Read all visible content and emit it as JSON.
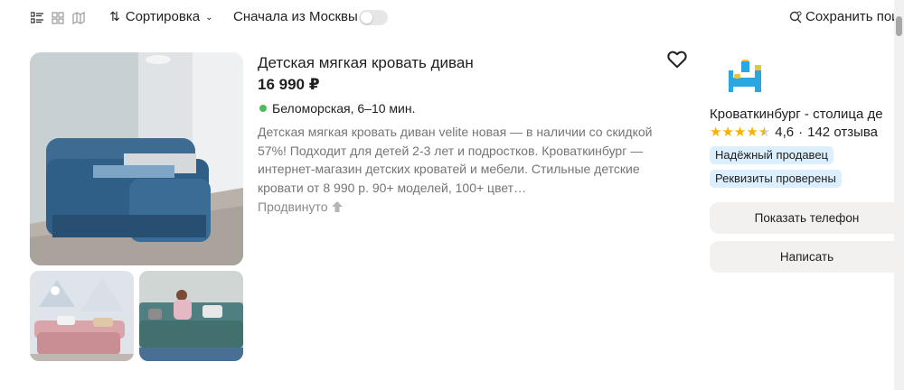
{
  "toolbar": {
    "view_icons": [
      "list-view-icon",
      "grid-view-icon",
      "map-view-icon"
    ],
    "sort_label": "Сортировка",
    "moscow_label": "Сначала из Москвы",
    "moscow_toggle": false,
    "save_label": "Сохранить пои"
  },
  "listing": {
    "title": "Детская мягкая кровать диван",
    "price": "16 990 ₽",
    "metro": "Беломорская, 6–10 мин.",
    "metro_color": "#4cbb5a",
    "description": "Детская мягкая кровать диван velite новая — в наличии со скидкой 57%! Подходит для детей 2-3 лет и подростков. Кроваткинбург — интернет-магазин детских кроватей и мебели. Стильные детские кровати от 8 990 р. 90+ моделей, 100+ цвет…",
    "promoted": "Продвинуто",
    "favorite_icon": "heart-icon"
  },
  "seller": {
    "name": "Кроваткинбург - столица де",
    "rating": "4,6",
    "rating_value": 4.6,
    "reviews": "142 отзыва",
    "badges": [
      "Надёжный продавец",
      "Реквизиты проверены"
    ],
    "badge_color": "#dcefff",
    "phone_button": "Показать телефон",
    "write_button": "Написать"
  }
}
